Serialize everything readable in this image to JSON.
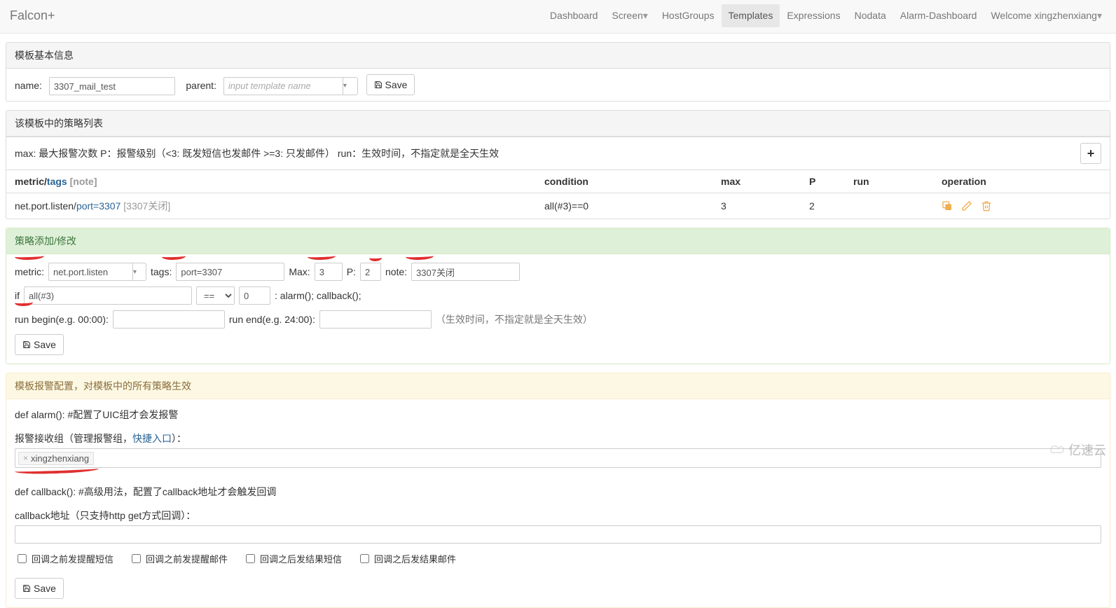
{
  "brand": "Falcon+",
  "nav": {
    "dashboard": "Dashboard",
    "screen": "Screen",
    "hostgroups": "HostGroups",
    "templates": "Templates",
    "expressions": "Expressions",
    "nodata": "Nodata",
    "alarm_dashboard": "Alarm-Dashboard",
    "welcome": "Welcome xingzhenxiang"
  },
  "panel1": {
    "heading": "模板基本信息",
    "name_label": "name:",
    "name_value": "3307_mail_test",
    "parent_label": "parent:",
    "parent_placeholder": "input template name",
    "save": "Save"
  },
  "panel2": {
    "heading": "该模板中的策略列表",
    "legend": "max: 最大报警次数 P：报警级别（<3: 既发短信也发邮件 >=3: 只发邮件） run：生效时间，不指定就是全天生效",
    "add": "+",
    "cols": {
      "metric": "metric/",
      "tags": "tags",
      "note": " [note]",
      "condition": "condition",
      "max": "max",
      "p": "P",
      "run": "run",
      "operation": "operation"
    },
    "row": {
      "metric": "net.port.listen/",
      "tags": "port=3307",
      "note": " [3307关闭]",
      "condition": "all(#3)==0",
      "max": "3",
      "p": "2",
      "run": ""
    }
  },
  "panel3": {
    "heading": "策略添加/修改",
    "metric_label": "metric:",
    "metric_value": "net.port.listen",
    "tags_label": "tags:",
    "tags_value": "port=3307",
    "max_label": "Max:",
    "max_value": "3",
    "p_label": "P:",
    "p_value": "2",
    "note_label": "note:",
    "note_value": "3307关闭",
    "if_label": "if",
    "func_value": "all(#3)",
    "op_value": "==",
    "rhs_value": "0",
    "alarm_text": ": alarm(); callback();",
    "runbegin_label": "run begin(e.g. 00:00):",
    "runend_label": "run end(e.g. 24:00):",
    "run_note": "（生效时间，不指定就是全天生效）",
    "save": "Save"
  },
  "panel4": {
    "heading": "模板报警配置，对模板中的所有策略生效",
    "alarm_def": "def alarm(): #配置了UIC组才会发报警",
    "recv_label_pre": "报警接收组（管理报警组，",
    "recv_link": "快捷入口",
    "recv_label_post": "）：",
    "recv_token": "xingzhenxiang",
    "callback_def": "def callback(): #高级用法，配置了callback地址才会触发回调",
    "callback_label": "callback地址（只支持http get方式回调）：",
    "chk1": "回调之前发提醒短信",
    "chk2": "回调之前发提醒邮件",
    "chk3": "回调之后发结果短信",
    "chk4": "回调之后发结果邮件",
    "save": "Save"
  },
  "footer": "亿速云"
}
